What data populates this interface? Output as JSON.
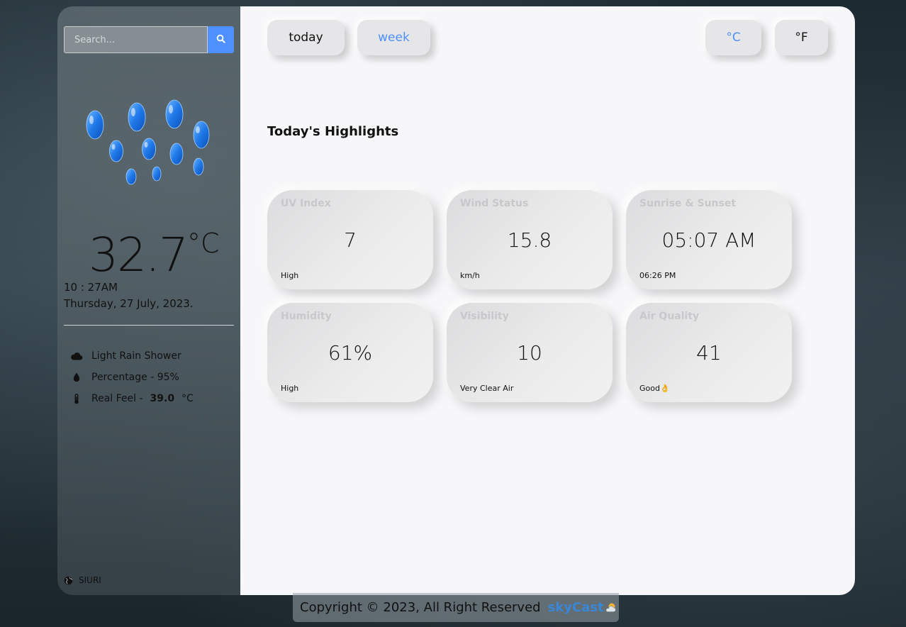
{
  "search": {
    "placeholder": "Search..."
  },
  "sidebar": {
    "temperature": "32.7",
    "temperature_unit": "°C",
    "time": "10 : 27AM",
    "date": "Thursday, 27 July, 2023.",
    "condition": "Light Rain Shower",
    "precipitation": "Percentage - 95%",
    "real_feel_label": "Real Feel -",
    "real_feel_value": "39.0",
    "real_feel_unit": "°C",
    "location": "SIURI"
  },
  "tabs": {
    "today": "today",
    "week": "week"
  },
  "units": {
    "celsius": "°C",
    "fahrenheit": "°F"
  },
  "highlights": {
    "title": "Today's Highlights",
    "cards": [
      {
        "title": "UV Index",
        "value": "7",
        "sub": "High"
      },
      {
        "title": "Wind Status",
        "value": "15.8",
        "sub": "km/h"
      },
      {
        "title": "Sunrise & Sunset",
        "value": "05:07 AM",
        "sub": "06:26 PM"
      },
      {
        "title": "Humidity",
        "value": "61%",
        "sub": "High"
      },
      {
        "title": "Visibility",
        "value": "10",
        "sub": "Very Clear Air"
      },
      {
        "title": "Air Quality",
        "value": "41",
        "sub": "Good👌"
      }
    ]
  },
  "footer": {
    "copyright": "Copyright © 2023, All Right Reserved",
    "brand": "skyCast"
  },
  "colors": {
    "accent": "#4d90fe",
    "brand": "#3a86d6",
    "panel": "#f7f7f9",
    "card": "#e6e6e8"
  }
}
